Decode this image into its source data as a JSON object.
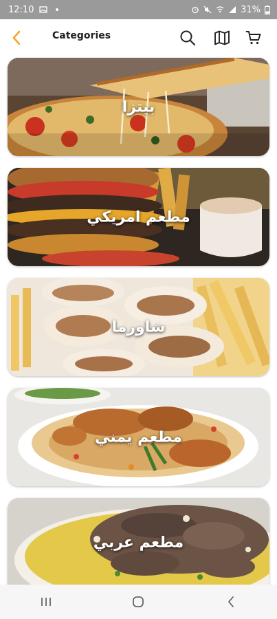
{
  "status_bar": {
    "time": "12:10",
    "battery": "31%"
  },
  "app_bar": {
    "title": "Categories",
    "icons": {
      "back": "chevron-left-icon",
      "search": "search-icon",
      "map": "map-icon",
      "cart": "cart-icon"
    },
    "accent_color": "#f5a623"
  },
  "categories": [
    {
      "label": "بيتزا",
      "image": "pizza"
    },
    {
      "label": "مطعم امريكي",
      "image": "burger"
    },
    {
      "label": "شاورما",
      "image": "shawarma"
    },
    {
      "label": "مطعم يمني",
      "image": "yemeni-rice"
    },
    {
      "label": "مطعم عربي",
      "image": "arabic-rice-meat"
    }
  ],
  "nav_bar": {
    "icons": [
      "recents-icon",
      "home-icon",
      "back-icon"
    ]
  }
}
